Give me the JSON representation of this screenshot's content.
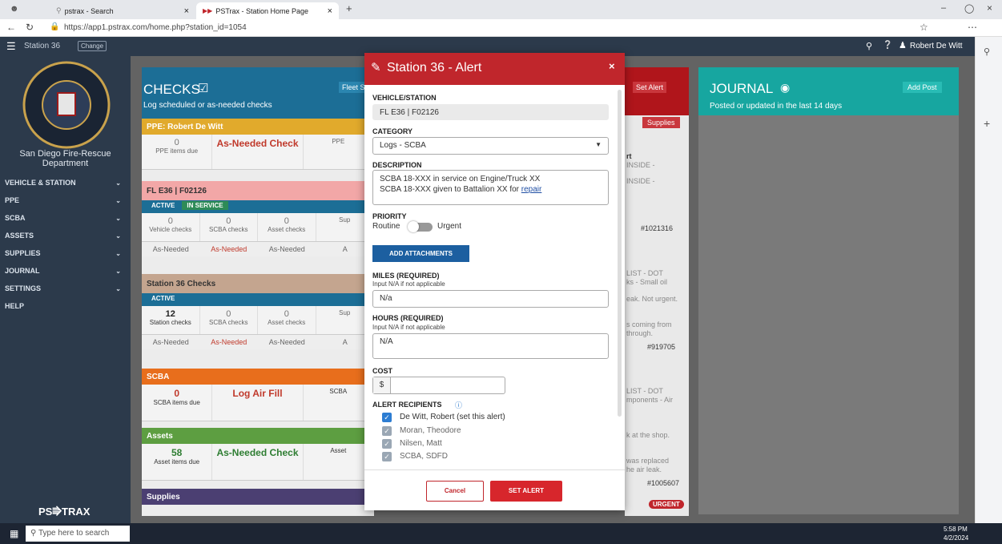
{
  "browser": {
    "tab1": "pstrax - Search",
    "tab2": "PSTrax - Station Home Page",
    "url": "https://app1.pstrax.com/home.php?station_id=1054"
  },
  "topnav": {
    "station": "Station 36",
    "change": "Change",
    "user": "Robert De Witt"
  },
  "sidebar": {
    "dept": "San Diego Fire-Rescue Department",
    "items": [
      "VEHICLE & STATION",
      "PPE",
      "SCBA",
      "ASSETS",
      "SUPPLIES",
      "JOURNAL",
      "SETTINGS",
      "HELP"
    ],
    "logo": "PS⭆TRAX"
  },
  "checks": {
    "title": "CHECKS",
    "subtitle": "Log scheduled or as-needed checks",
    "fleet": "Fleet S",
    "ppe": {
      "head": "PPE: Robert De Witt",
      "count": "0",
      "count_label": "PPE items due",
      "action": "As-Needed Check",
      "cut": "PPE"
    },
    "vehicle": {
      "head": "FL E36 | F02126",
      "badge1": "ACTIVE",
      "badge2": "IN SERVICE",
      "cells": [
        {
          "n": "0",
          "l": "Vehicle checks"
        },
        {
          "n": "0",
          "l": "SCBA checks"
        },
        {
          "n": "0",
          "l": "Asset checks"
        },
        {
          "n": "",
          "l": "Sup"
        }
      ],
      "row": [
        "As-Needed",
        "As-Needed",
        "As-Needed",
        "A"
      ]
    },
    "station": {
      "head": "Station 36 Checks",
      "badge1": "ACTIVE",
      "cells": [
        {
          "n": "12",
          "l": "Station checks"
        },
        {
          "n": "0",
          "l": "SCBA checks"
        },
        {
          "n": "0",
          "l": "Asset checks"
        },
        {
          "n": "",
          "l": "Sup"
        }
      ],
      "row": [
        "As-Needed",
        "As-Needed",
        "As-Needed",
        "A"
      ]
    },
    "scba": {
      "head": "SCBA",
      "count": "0",
      "count_label": "SCBA items due",
      "action": "Log Air Fill",
      "cut": "SCBA"
    },
    "assets": {
      "head": "Assets",
      "count": "58",
      "count_label": "Asset items due",
      "action": "As-Needed Check",
      "cut": "Asset"
    },
    "supplies": {
      "head": "Supplies"
    }
  },
  "midcol": {
    "setalert": "Set Alert",
    "supplies": "Supplies",
    "snips": [
      "rt",
      "INSIDE -",
      "INSIDE -",
      "#1021316",
      "LIST - DOT",
      "ks - Small oil",
      "eak. Not urgent.",
      "s coming from",
      "through.",
      "#919705",
      "LIST - DOT",
      "mponents - Air",
      "k at the shop.",
      "was replaced",
      "he air leak.",
      "#1005607",
      "URGENT"
    ]
  },
  "journal": {
    "title": "JOURNAL",
    "subtitle": "Posted or updated in the last 14 days",
    "add": "Add Post"
  },
  "modal": {
    "title": "Station 36 - Alert",
    "vehicle_label": "VEHICLE/STATION",
    "vehicle_value": "FL E36 | F02126",
    "category_label": "CATEGORY",
    "category_value": "Logs - SCBA",
    "description_label": "DESCRIPTION",
    "description_line1": "SCBA 18-XXX in service on Engine/Truck XX",
    "description_line2a": "SCBA 18-XXX given to Battalion XX for ",
    "description_line2b": "repair",
    "priority_label": "PRIORITY",
    "priority_left": "Routine",
    "priority_right": "Urgent",
    "attach": "ADD ATTACHMENTS",
    "miles_label": "MILES (REQUIRED)",
    "miles_hint": "Input N/A if not applicable",
    "miles_value": "N/a",
    "hours_label": "HOURS (REQUIRED)",
    "hours_hint": "Input N/A if not applicable",
    "hours_value": "N/A",
    "cost_label": "COST",
    "cost_prefix": "$",
    "recipients_label": "ALERT RECIPIENTS",
    "recipients": [
      "De Witt, Robert (set this alert)",
      "Moran, Theodore",
      "Nilsen, Matt",
      "SCBA, SDFD"
    ],
    "cancel": "Cancel",
    "submit": "SET ALERT"
  },
  "taskbar": {
    "search": "Type here to search",
    "time": "5:58 PM",
    "date": "4/2/2024"
  }
}
